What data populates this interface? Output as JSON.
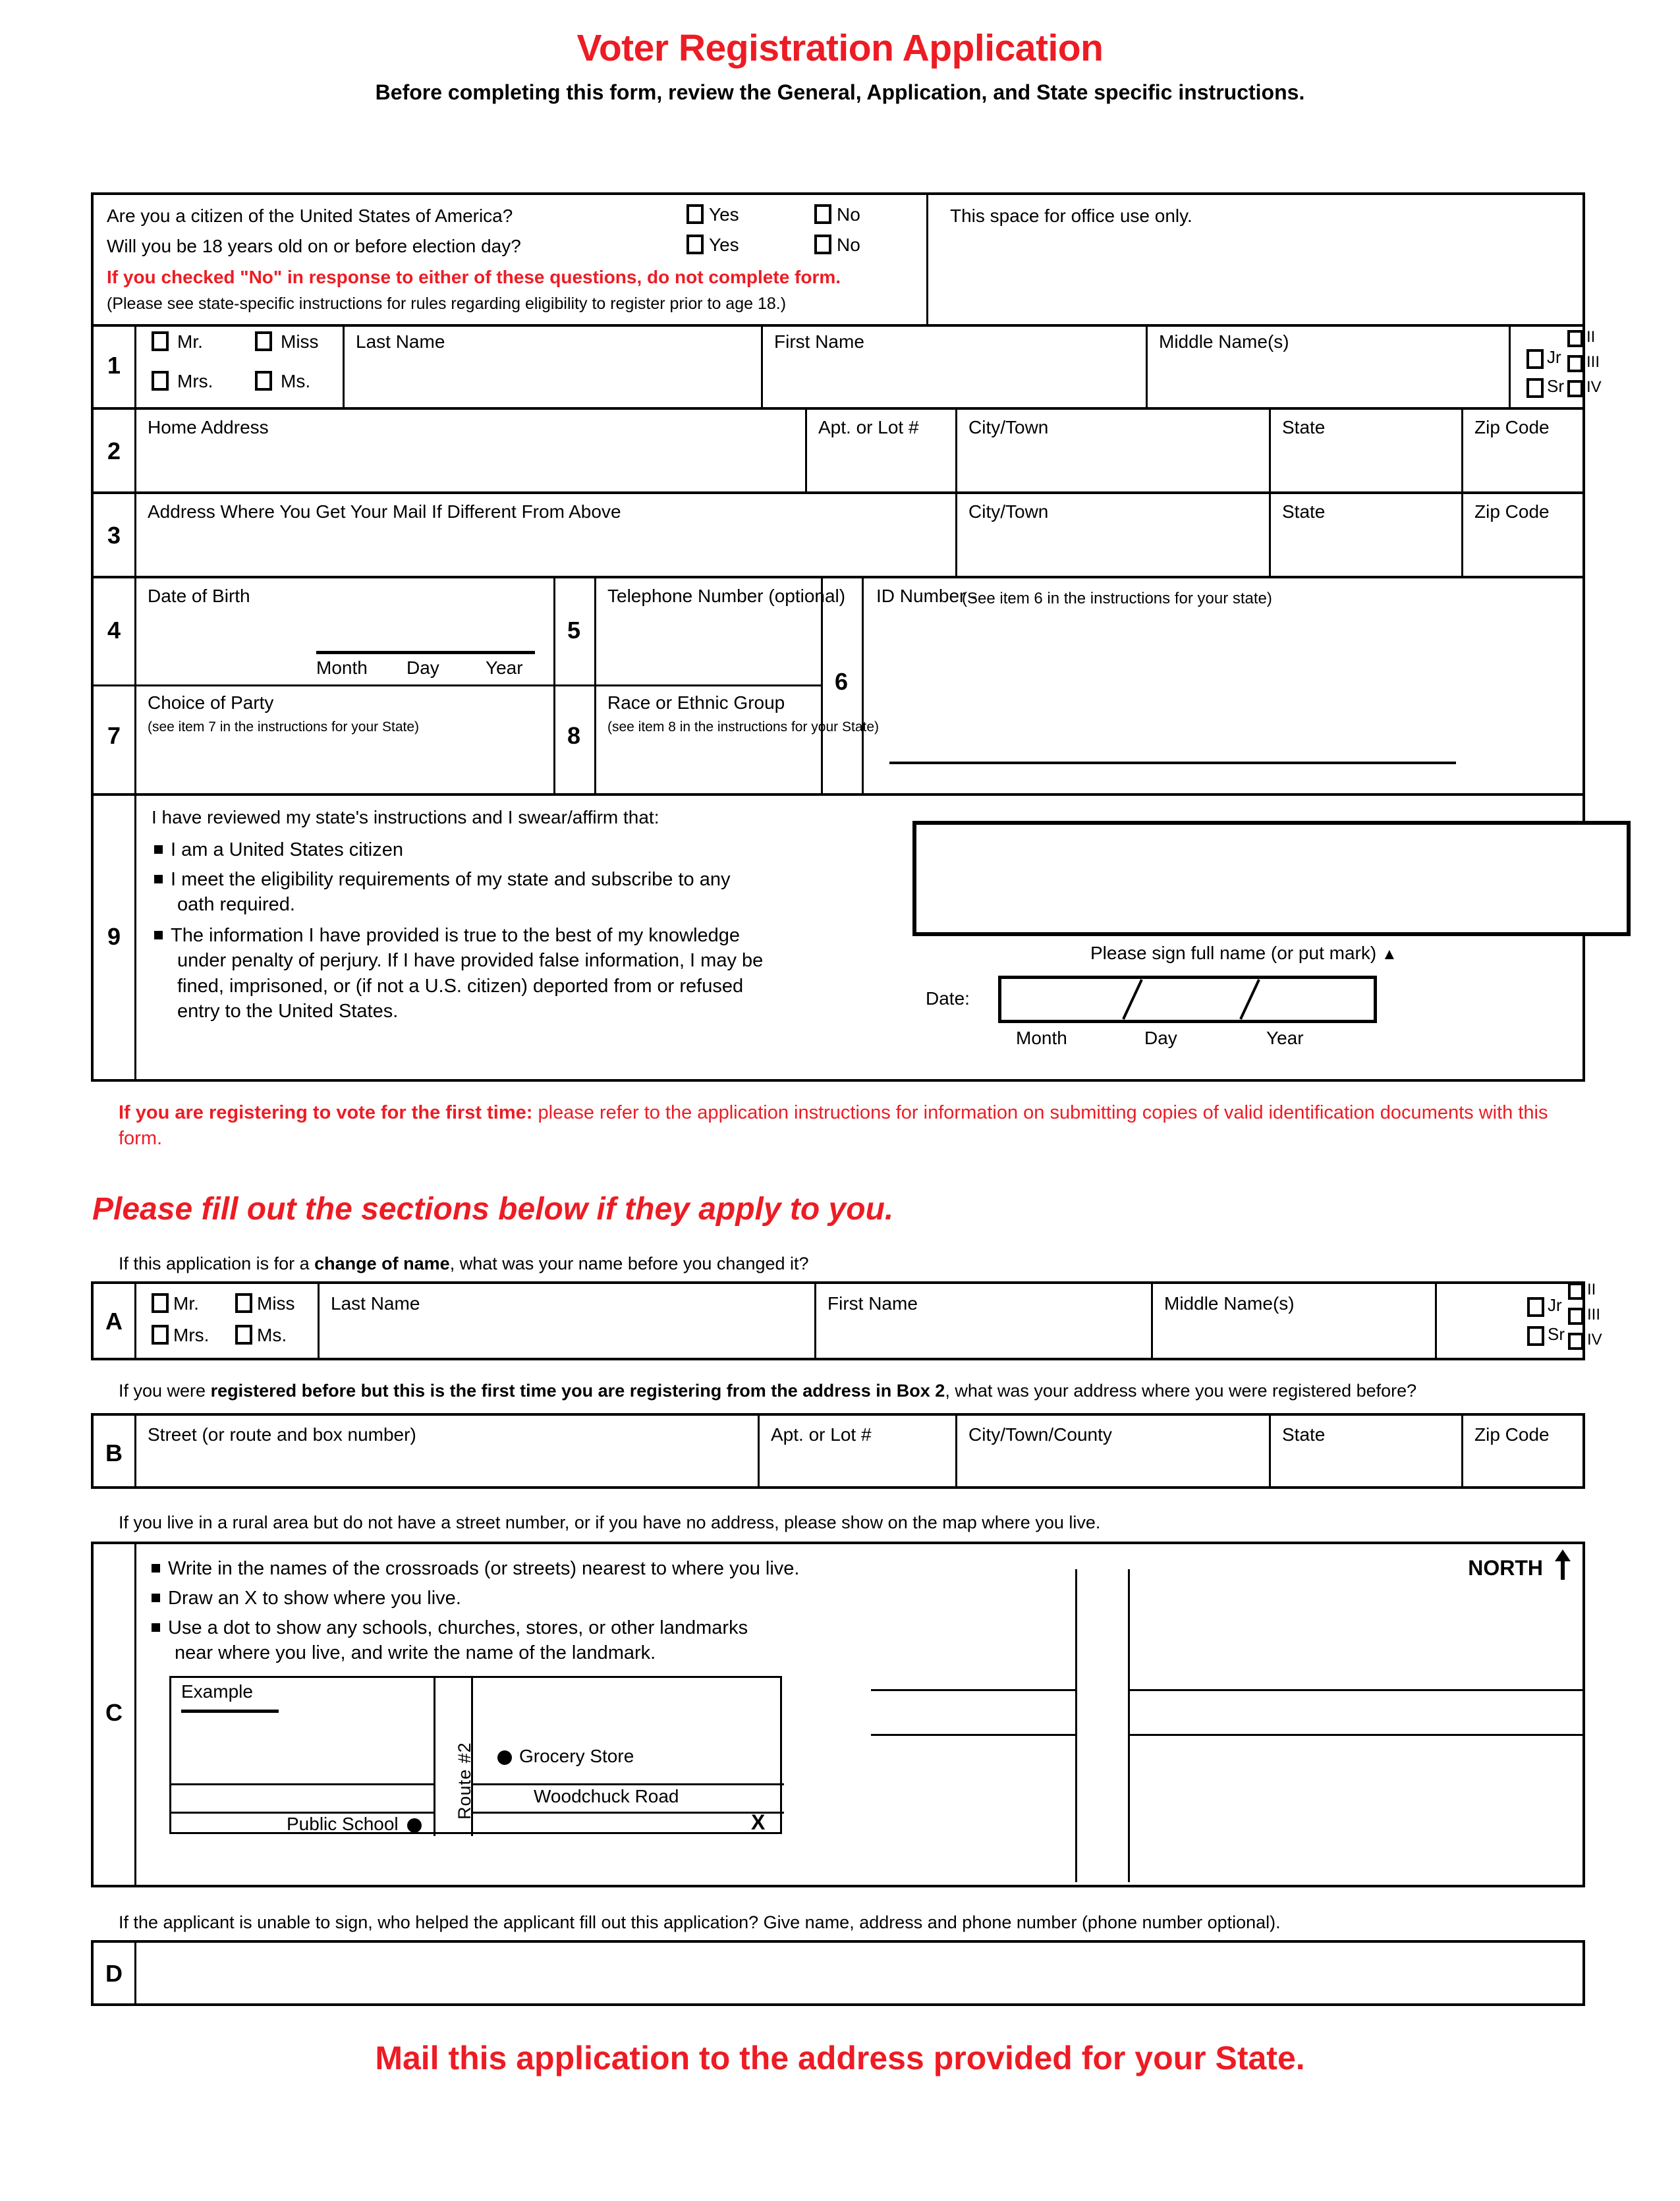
{
  "header": {
    "title": "Voter Registration Application",
    "subtitle": "Before completing this form, review the General, Application, and State specific instructions."
  },
  "eligibility": {
    "q1": "Are you a citizen of the United States of America?",
    "q2": "Will you be 18 years old on or before election day?",
    "yes": "Yes",
    "no": "No",
    "warning": "If you checked \"No\" in response to either of these questions, do not complete form.",
    "note": "(Please see state-specific instructions for rules regarding eligibility to register prior to age 18.)",
    "office_use": "This space for office use only."
  },
  "row1": {
    "num": "1",
    "titles": [
      "Mr.",
      "Miss",
      "Mrs.",
      "Ms."
    ],
    "last_name": "Last Name",
    "first_name": "First Name",
    "middle_name": "Middle Name(s)",
    "suffix_jr": "Jr",
    "suffix_sr": "Sr",
    "suffix_ii": "II",
    "suffix_iii": "III",
    "suffix_iv": "IV"
  },
  "row2": {
    "num": "2",
    "home_address": "Home Address",
    "apt": "Apt. or Lot #",
    "city": "City/Town",
    "state": "State",
    "zip": "Zip Code"
  },
  "row3": {
    "num": "3",
    "mail_address": "Address Where You Get Your Mail If Different From Above",
    "city": "City/Town",
    "state": "State",
    "zip": "Zip Code"
  },
  "row4": {
    "num": "4",
    "label": "Date of Birth",
    "month": "Month",
    "day": "Day",
    "year": "Year"
  },
  "row5": {
    "num": "5",
    "label": "Telephone Number (optional)"
  },
  "row6": {
    "num": "6",
    "label": "ID Number -",
    "sublabel": "(See item 6 in the instructions for your state)"
  },
  "row7": {
    "num": "7",
    "label": "Choice of Party",
    "sublabel": "(see item 7  in the instructions for your State)"
  },
  "row8": {
    "num": "8",
    "label": "Race or Ethnic Group",
    "sublabel": "(see item 8 in the instructions for your State)"
  },
  "row9": {
    "num": "9",
    "intro": "I have reviewed my state's instructions and I swear/affirm that:",
    "bullets": [
      "I am a United States citizen",
      "I meet the eligibility requirements of my state and subscribe to any oath required.",
      "The information I have provided is true to the best of my knowledge under penalty of perjury. If I have provided false information, I may be fined, imprisoned, or (if not a U.S. citizen) deported from or refused entry to the United States."
    ],
    "sign_caption": "Please sign full name (or put mark)",
    "date_label": "Date:",
    "month": "Month",
    "day": "Day",
    "year": "Year"
  },
  "first_time_note": {
    "bold": "If you are registering to vote for the first time:",
    "rest": " please refer to the application instructions for information on submitting copies of valid identification documents with this form."
  },
  "section_heading": "Please fill out the sections below if they apply to you.",
  "sectionA": {
    "letter": "A",
    "caption_pre": "If this application is for a ",
    "caption_bold": "change of name",
    "caption_post": ", what was your name before you changed it?",
    "titles": [
      "Mr.",
      "Miss",
      "Mrs.",
      "Ms."
    ],
    "last_name": "Last Name",
    "first_name": "First Name",
    "middle_name": "Middle Name(s)",
    "suffix_jr": "Jr",
    "suffix_sr": "Sr",
    "suffix_ii": "II",
    "suffix_iii": "III",
    "suffix_iv": "IV"
  },
  "sectionB": {
    "letter": "B",
    "caption_pre": "If you were ",
    "caption_bold": "registered before but this is the first time you are registering from the address in Box 2",
    "caption_post": ", what was your address where you were registered before?",
    "street": "Street (or route and box number)",
    "apt": "Apt. or Lot #",
    "city": "City/Town/County",
    "state": "State",
    "zip": "Zip Code"
  },
  "sectionC": {
    "letter": "C",
    "caption": "If you live in a rural area but do not have a street number, or if you have no address, please show on the map where you live.",
    "bullets": [
      "Write in the names of the crossroads (or streets) nearest to where you live.",
      "Draw an X to show where you live.",
      "Use a dot to show any schools, churches, stores, or other landmarks near where you live, and write the name of the landmark."
    ],
    "example_label": "Example",
    "route_label": "Route #2",
    "grocery_label": "Grocery Store",
    "road_label": "Woodchuck Road",
    "school_label": "Public School",
    "x_mark": "X",
    "north_label": "NORTH"
  },
  "sectionD": {
    "letter": "D",
    "caption": "If the applicant is unable to sign, who helped the applicant fill out this application? Give name, address and phone number (phone number optional)."
  },
  "footer": "Mail this application to the address provided for your State.",
  "colors": {
    "red": "#ed1c24",
    "black": "#000000"
  }
}
